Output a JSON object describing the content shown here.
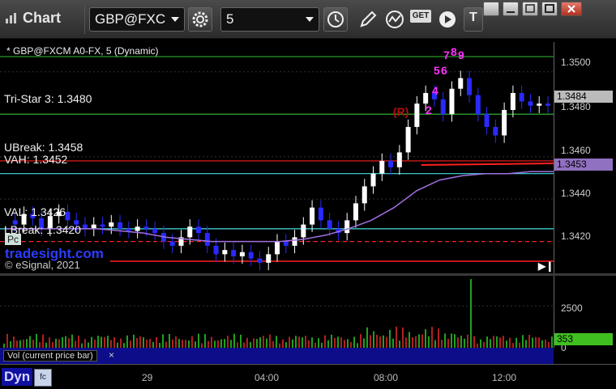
{
  "toolbar": {
    "title": "Chart",
    "symbol": "GBP@FXC",
    "interval": "5",
    "icons": [
      "settings-gear-icon",
      "clock-icon",
      "pencil-icon",
      "study-icon",
      "get-icon",
      "play-icon",
      "text-tool-icon"
    ],
    "get_label": "GET",
    "text_tool_label": "T"
  },
  "chart_header": "* GBP@FXCM A0-FX, 5 (Dynamic)",
  "watermark": "tradesight.com",
  "copyright": "© eSignal, 2021",
  "pc_tag": "Pc",
  "volume_caption": "Vol (current price bar)",
  "volume_close": "×",
  "footer": {
    "mode": "Dyn",
    "icon_text": "fc"
  },
  "level_labels": {
    "tristar": "Tri-Star 3: 1.3480",
    "ubreak": "UBreak: 1.3458",
    "vah": "VAH: 1.3452",
    "val": "VAL: 1.3426",
    "lbreak": "LBreak: 1.3420"
  },
  "annotations": {
    "r_marker": "(R)",
    "seq": [
      "7",
      "8",
      "9",
      "5",
      "6",
      "4",
      "2"
    ]
  },
  "colors": {
    "up_candle": "#ffffff",
    "down_candle": "#2a2aff",
    "vwap": "#a070e0",
    "red_line": "#ff2020",
    "cyan_line": "#40e0e0",
    "green_line": "#30c030",
    "magenta": "#ff30ff",
    "current_price_tag": "#bbbbbb",
    "vwap_tag": "#9070c0",
    "volume_tag": "#40c020"
  },
  "chart_data": {
    "type": "candlestick",
    "y_axis": {
      "ticks": [
        "1.3500",
        "1.3480",
        "1.3460",
        "1.3440",
        "1.3420"
      ],
      "range": [
        1.3405,
        1.3514
      ]
    },
    "x_axis": {
      "ticks": [
        "29",
        "04:00",
        "08:00",
        "12:00"
      ]
    },
    "current_price": "1.3484",
    "vwap_price": "1.3453",
    "levels": [
      {
        "name": "Tri-Star 3",
        "price": 1.348
      },
      {
        "name": "UBreak",
        "price": 1.3458
      },
      {
        "name": "VAH",
        "price": 1.3452
      },
      {
        "name": "VAL",
        "price": 1.3426
      },
      {
        "name": "LBreak",
        "price": 1.342
      }
    ],
    "price_path": [
      1.343,
      1.3428,
      1.3433,
      1.3431,
      1.3426,
      1.3432,
      1.3434,
      1.343,
      1.3428,
      1.3426,
      1.3428,
      1.3427,
      1.3429,
      1.3426,
      1.3425,
      1.3427,
      1.3426,
      1.3424,
      1.342,
      1.3418,
      1.3422,
      1.3427,
      1.3424,
      1.3418,
      1.3414,
      1.3416,
      1.3413,
      1.3415,
      1.3412,
      1.341,
      1.3414,
      1.342,
      1.3418,
      1.3422,
      1.3428,
      1.3436,
      1.343,
      1.3426,
      1.3424,
      1.343,
      1.3438,
      1.3446,
      1.3452,
      1.3458,
      1.3455,
      1.3462,
      1.3474,
      1.3485,
      1.349,
      1.3487,
      1.348,
      1.3492,
      1.3497,
      1.3489,
      1.348,
      1.3474,
      1.347,
      1.3482,
      1.349,
      1.3486,
      1.3484,
      1.3485,
      1.3484
    ],
    "vwap_path": [
      1.3426,
      1.3426,
      1.3426,
      1.3426,
      1.3426,
      1.3425,
      1.3424,
      1.3422,
      1.3421,
      1.342,
      1.342,
      1.342,
      1.342,
      1.3421,
      1.3423,
      1.3426,
      1.343,
      1.3436,
      1.3444,
      1.3449,
      1.3451,
      1.3452,
      1.3452,
      1.3453,
      1.3453
    ],
    "volume": {
      "ticks": [
        "2500",
        "0"
      ],
      "range": [
        0,
        4200
      ],
      "current": "353",
      "spike_value": 4100
    }
  }
}
